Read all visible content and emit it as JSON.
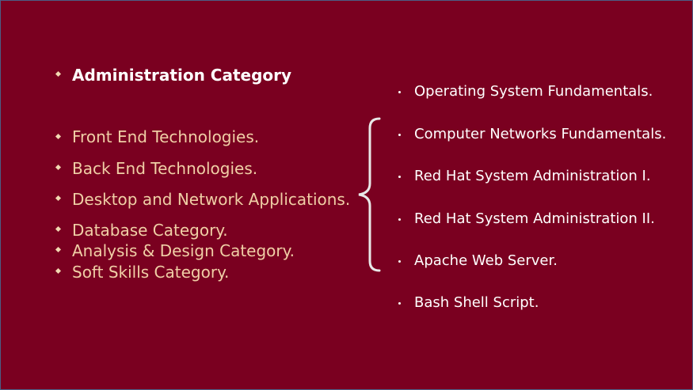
{
  "slide": {
    "colors": {
      "background": "#7a0020",
      "left_text": "#f0cfa6",
      "heading_text": "#ffffff",
      "right_text": "#ffffff",
      "brace": "#e8e8e8"
    },
    "heading": "Administration Category",
    "left_items": [
      "Front End Technologies.",
      "Back End Technologies.",
      "Desktop and Network Applications.",
      "Database Category.",
      "Analysis & Design Category.",
      "Soft Skills Category."
    ],
    "right_items": [
      "Operating System Fundamentals.",
      "Computer Networks Fundamentals.",
      "Red Hat System Administration I.",
      "Red Hat System Administration II.",
      "Apache Web Server.",
      "Bash Shell Script."
    ]
  }
}
